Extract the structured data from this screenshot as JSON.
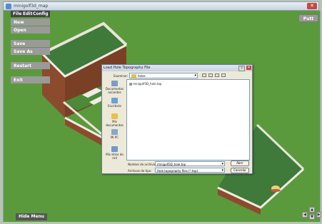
{
  "window": {
    "title": "minigolf3d_map"
  },
  "menubar": {
    "file": "File",
    "edit": "Edit",
    "config": "Config"
  },
  "menu_items": [
    "New",
    "Open",
    "Save",
    "Save As",
    "Restart",
    "Exit"
  ],
  "buttons": {
    "putt": "Putt",
    "hide_menu": "Hide Menu"
  },
  "dialog": {
    "title": "Load Hole Topography File",
    "lookin_label": "Examinar:",
    "lookin_value": "holes",
    "places": [
      "Documentos recientes",
      "Escritorio",
      "Mis documentos",
      "Mi PC",
      "Mis sitios de red"
    ],
    "file": "minigolf3D_hole.top",
    "filename_label": "Nombre de archivo:",
    "filename_value": "minigolf3D_hole.top",
    "filetype_label": "Archivos de tipo:",
    "filetype_value": "Hole topography files (*.top)",
    "open_button": "Abrir",
    "cancel_button": "Cancelar"
  },
  "colors": {
    "grass": "#5a9a3c",
    "green": "#3f7a3b",
    "wall": "#e9e4d8",
    "brick": "#8c4b2c"
  }
}
